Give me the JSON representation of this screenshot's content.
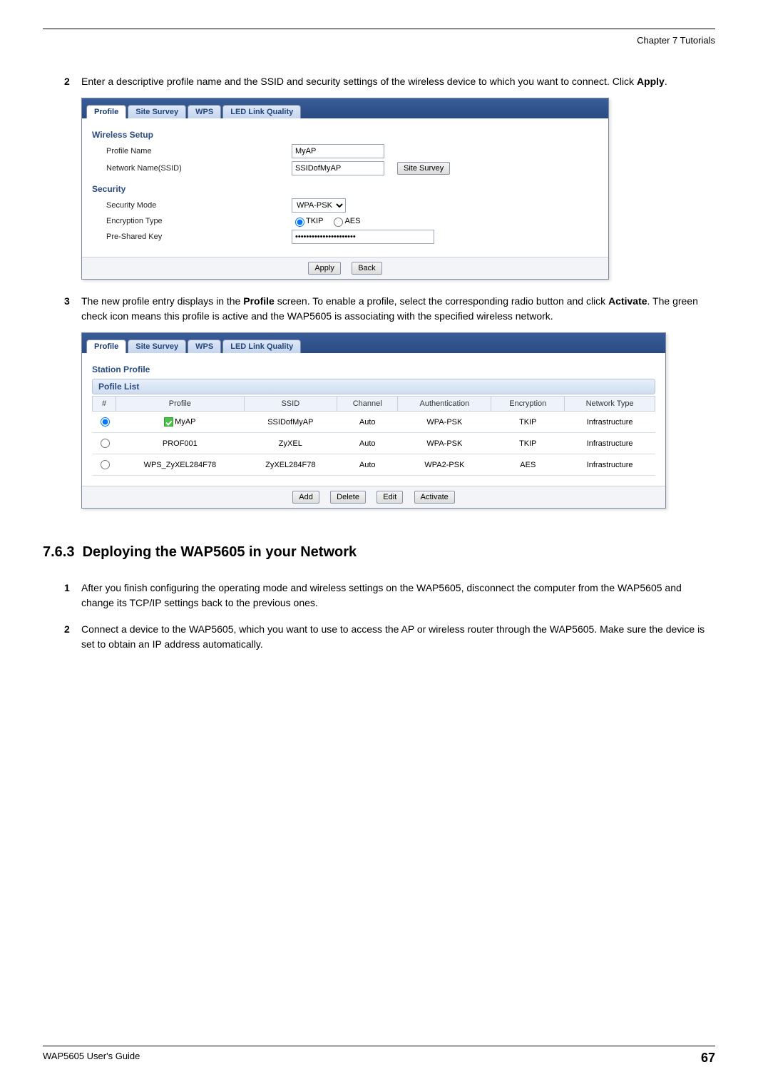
{
  "header": {
    "chapter": "Chapter 7 Tutorials"
  },
  "footer": {
    "guide": "WAP5605 User's Guide",
    "page": "67"
  },
  "steps_a": {
    "s2": {
      "num": "2",
      "text_a": "Enter a descriptive profile name and the SSID and security settings of the wireless device to which you want to connect. Click ",
      "bold": "Apply",
      "text_b": "."
    },
    "s3": {
      "num": "3",
      "text_a": "The new profile entry displays in the ",
      "bold1": "Profile",
      "text_b": " screen. To enable a profile, select the corresponding radio button and click ",
      "bold2": "Activate",
      "text_c": ". The green check icon means this profile is active and the WAP5605 is associating with the specified wireless network."
    }
  },
  "section": {
    "num": "7.6.3",
    "title": "Deploying the WAP5605 in your Network"
  },
  "steps_b": {
    "s1": {
      "num": "1",
      "text": "After you finish configuring the operating mode and wireless settings on the WAP5605, disconnect the computer from the WAP5605 and change its TCP/IP settings back to the previous ones."
    },
    "s2": {
      "num": "2",
      "text": "Connect a device to the WAP5605, which you want to use to access the AP or wireless router through the WAP5605. Make sure the device is set to obtain an IP address automatically."
    }
  },
  "panel1": {
    "tabs": {
      "t0": "Profile",
      "t1": "Site Survey",
      "t2": "WPS",
      "t3": "LED Link Quality"
    },
    "group_wireless": "Wireless Setup",
    "labels": {
      "profile_name": "Profile Name",
      "ssid": "Network Name(SSID)"
    },
    "values": {
      "profile_name": "MyAP",
      "ssid": "SSIDofMyAP",
      "psk": "••••••••••••••••••••••"
    },
    "buttons": {
      "site_survey": "Site Survey",
      "apply": "Apply",
      "back": "Back"
    },
    "group_security": "Security",
    "sec_labels": {
      "mode": "Security Mode",
      "enc": "Encryption Type",
      "psk": "Pre-Shared Key"
    },
    "sec_values": {
      "mode": "WPA-PSK",
      "tkip": "TKIP",
      "aes": "AES"
    }
  },
  "panel2": {
    "tabs": {
      "t0": "Profile",
      "t1": "Site Survey",
      "t2": "WPS",
      "t3": "LED Link Quality"
    },
    "group": "Station Profile",
    "list_title": "Pofile List",
    "cols": {
      "c0": "#",
      "c1": "Profile",
      "c2": "SSID",
      "c3": "Channel",
      "c4": "Authentication",
      "c5": "Encryption",
      "c6": "Network Type"
    },
    "rows": [
      {
        "selected": true,
        "active": true,
        "profile": "MyAP",
        "ssid": "SSIDofMyAP",
        "channel": "Auto",
        "auth": "WPA-PSK",
        "enc": "TKIP",
        "ntype": "Infrastructure"
      },
      {
        "selected": false,
        "active": false,
        "profile": "PROF001",
        "ssid": "ZyXEL",
        "channel": "Auto",
        "auth": "WPA-PSK",
        "enc": "TKIP",
        "ntype": "Infrastructure"
      },
      {
        "selected": false,
        "active": false,
        "profile": "WPS_ZyXEL284F78",
        "ssid": "ZyXEL284F78",
        "channel": "Auto",
        "auth": "WPA2-PSK",
        "enc": "AES",
        "ntype": "Infrastructure"
      }
    ],
    "buttons": {
      "add": "Add",
      "delete": "Delete",
      "edit": "Edit",
      "activate": "Activate"
    }
  }
}
